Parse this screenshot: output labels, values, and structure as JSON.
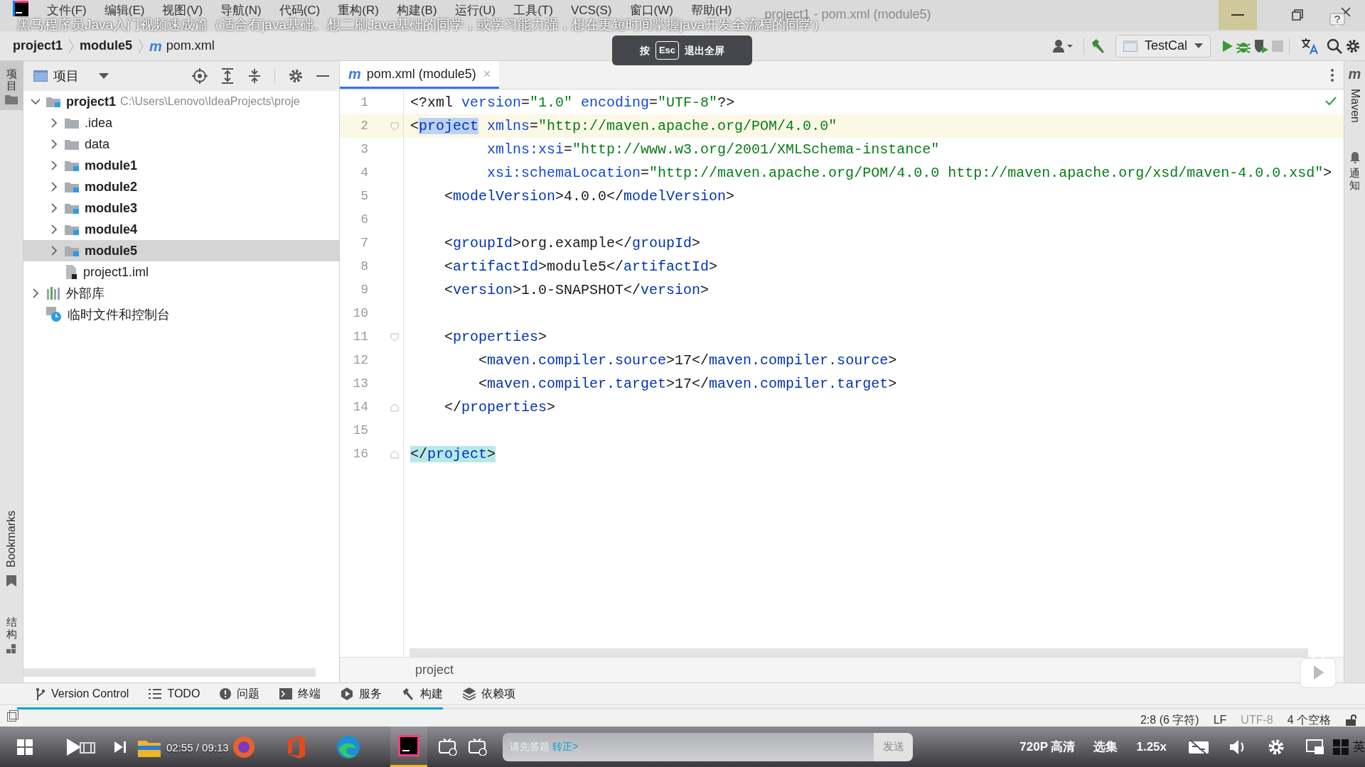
{
  "window": {
    "title": "project1 - pom.xml (module5)",
    "minimize_hovered": true,
    "menu": [
      "文件(F)",
      "编辑(E)",
      "视图(V)",
      "导航(N)",
      "代码(C)",
      "重构(R)",
      "构建(B)",
      "运行(U)",
      "工具(T)",
      "VCS(S)",
      "窗口(W)",
      "帮助(H)"
    ]
  },
  "video": {
    "title": "黑马程序员Java入门视频速成篇（适合有java基础、想二刷Java基础的同学，或学习能力强，想在更短时间掌握java开发全流程的同学）",
    "esc_hint": {
      "prefix": "按",
      "key": "Esc",
      "suffix": "退出全屏"
    },
    "progress": {
      "level": 0.316
    },
    "time_current": "02:55",
    "time_separator": "/",
    "time_total": "09:13",
    "danmaku": {
      "placeholder": "请先答题",
      "link": "转正>",
      "send": "发送"
    },
    "quality": "720P 高清",
    "episodes": "选集",
    "speed": "1.25x"
  },
  "breadcrumb": {
    "items": [
      "project1",
      "module5"
    ],
    "file_icon": "m",
    "file": "pom.xml"
  },
  "toolbar": {
    "run_config": "TestCal",
    "stop_enabled": false
  },
  "left_stripe": [
    {
      "kind": "vertical",
      "label": "项目",
      "selected": true
    },
    {
      "kind": "rotated",
      "label": "Bookmarks",
      "selected": false
    },
    {
      "kind": "vertical",
      "label": "结构",
      "selected": false
    }
  ],
  "project_panel": {
    "title": "项目",
    "tree": [
      {
        "label": "project1",
        "path": "C:\\Users\\Lenovo\\IdeaProjects\\proje",
        "kind": "project",
        "expanded": true,
        "selected": false,
        "children": [
          {
            "label": ".idea",
            "kind": "folder",
            "expanded": false,
            "selected": false
          },
          {
            "label": "data",
            "kind": "folder",
            "expanded": false,
            "selected": false
          },
          {
            "label": "module1",
            "kind": "module",
            "expanded": false,
            "selected": false
          },
          {
            "label": "module2",
            "kind": "module",
            "expanded": false,
            "selected": false
          },
          {
            "label": "module3",
            "kind": "module",
            "expanded": false,
            "selected": false
          },
          {
            "label": "module4",
            "kind": "module",
            "expanded": false,
            "selected": false
          },
          {
            "label": "module5",
            "kind": "module",
            "expanded": false,
            "selected": true
          },
          {
            "label": "project1.iml",
            "kind": "file",
            "selected": false
          }
        ]
      },
      {
        "label": "外部库",
        "kind": "library",
        "expanded": false,
        "selected": false
      },
      {
        "label": "临时文件和控制台",
        "kind": "scratch",
        "selected": false
      }
    ]
  },
  "editor": {
    "tab": {
      "icon": "m",
      "label": "pom.xml (module5)",
      "close": "×",
      "selected": true
    },
    "lines": [
      {
        "number": "1",
        "current": false,
        "tokens": [
          {
            "kind": "punct",
            "text": "<?xml "
          },
          {
            "kind": "attr",
            "text": "version"
          },
          {
            "kind": "punct",
            "text": "="
          },
          {
            "kind": "value",
            "text": "\"1.0\""
          },
          {
            "kind": "attr",
            "text": " encoding"
          },
          {
            "kind": "punct",
            "text": "="
          },
          {
            "kind": "value",
            "text": "\"UTF-8\""
          },
          {
            "kind": "punct",
            "text": "?>"
          }
        ]
      },
      {
        "number": "2",
        "current": true,
        "fold_start": true,
        "tokens": [
          {
            "kind": "punct",
            "text": "<"
          },
          {
            "kind": "tag",
            "text": "project",
            "selected": true
          },
          {
            "kind": "attr",
            "text": " xmlns"
          },
          {
            "kind": "punct",
            "text": "="
          },
          {
            "kind": "value",
            "text": "\"http://maven.apache.org/POM/4.0.0\""
          }
        ]
      },
      {
        "number": "3",
        "current": false,
        "tokens": [
          {
            "kind": "attr",
            "text": "         xmlns:xsi"
          },
          {
            "kind": "punct",
            "text": "="
          },
          {
            "kind": "value",
            "text": "\"http://www.w3.org/2001/XMLSchema-instance\""
          }
        ]
      },
      {
        "number": "4",
        "current": false,
        "tokens": [
          {
            "kind": "attr",
            "text": "         xsi:schemaLocation"
          },
          {
            "kind": "punct",
            "text": "="
          },
          {
            "kind": "value",
            "text": "\"http://maven.apache.org/POM/4.0.0 http://maven.apache.org/xsd/maven-4.0.0.xsd\""
          },
          {
            "kind": "punct",
            "text": ">"
          }
        ]
      },
      {
        "number": "5",
        "current": false,
        "tokens": [
          {
            "kind": "punct",
            "text": "    <"
          },
          {
            "kind": "tag",
            "text": "modelVersion"
          },
          {
            "kind": "punct",
            "text": ">4.0.0</"
          },
          {
            "kind": "tag",
            "text": "modelVersion"
          },
          {
            "kind": "punct",
            "text": ">"
          }
        ]
      },
      {
        "number": "6",
        "current": false
      },
      {
        "number": "7",
        "current": false,
        "tokens": [
          {
            "kind": "punct",
            "text": "    <"
          },
          {
            "kind": "tag",
            "text": "groupId"
          },
          {
            "kind": "punct",
            "text": ">org.example</"
          },
          {
            "kind": "tag",
            "text": "groupId"
          },
          {
            "kind": "punct",
            "text": ">"
          }
        ]
      },
      {
        "number": "8",
        "current": false,
        "tokens": [
          {
            "kind": "punct",
            "text": "    <"
          },
          {
            "kind": "tag",
            "text": "artifactId"
          },
          {
            "kind": "punct",
            "text": ">module5</"
          },
          {
            "kind": "tag",
            "text": "artifactId"
          },
          {
            "kind": "punct",
            "text": ">"
          }
        ]
      },
      {
        "number": "9",
        "current": false,
        "tokens": [
          {
            "kind": "punct",
            "text": "    <"
          },
          {
            "kind": "tag",
            "text": "version"
          },
          {
            "kind": "punct",
            "text": ">1.0-SNAPSHOT</"
          },
          {
            "kind": "tag",
            "text": "version"
          },
          {
            "kind": "punct",
            "text": ">"
          }
        ]
      },
      {
        "number": "10",
        "current": false
      },
      {
        "number": "11",
        "current": false,
        "fold_start": true,
        "tokens": [
          {
            "kind": "punct",
            "text": "    <"
          },
          {
            "kind": "tag",
            "text": "properties"
          },
          {
            "kind": "punct",
            "text": ">"
          }
        ]
      },
      {
        "number": "12",
        "current": false,
        "tokens": [
          {
            "kind": "punct",
            "text": "        <"
          },
          {
            "kind": "tag",
            "text": "maven.compiler.source"
          },
          {
            "kind": "punct",
            "text": ">17</"
          },
          {
            "kind": "tag",
            "text": "maven.compiler.source"
          },
          {
            "kind": "punct",
            "text": ">"
          }
        ]
      },
      {
        "number": "13",
        "current": false,
        "tokens": [
          {
            "kind": "punct",
            "text": "        <"
          },
          {
            "kind": "tag",
            "text": "maven.compiler.target"
          },
          {
            "kind": "punct",
            "text": ">17</"
          },
          {
            "kind": "tag",
            "text": "maven.compiler.target"
          },
          {
            "kind": "punct",
            "text": ">"
          }
        ]
      },
      {
        "number": "14",
        "current": false,
        "fold_end": true,
        "tokens": [
          {
            "kind": "punct",
            "text": "    </"
          },
          {
            "kind": "tag",
            "text": "properties"
          },
          {
            "kind": "punct",
            "text": ">"
          }
        ]
      },
      {
        "number": "15",
        "current": false
      },
      {
        "number": "16",
        "current": false,
        "fold_end": true,
        "tokens": [
          {
            "kind": "punct",
            "text": "</",
            "matched": true
          },
          {
            "kind": "tag",
            "text": "project",
            "matched": true
          },
          {
            "kind": "punct",
            "text": ">",
            "matched": true
          }
        ]
      }
    ],
    "path": "project"
  },
  "right_stripe": [
    {
      "kind": "rotated",
      "icon": "m",
      "label": "Maven"
    },
    {
      "kind": "vertical",
      "label": "通知"
    }
  ],
  "tool_windows": [
    "Version Control",
    "TODO",
    "问题",
    "终端",
    "服务",
    "构建",
    "依赖项"
  ],
  "status": {
    "position": "2:8 (6 字符)",
    "line_separator": "LF",
    "encoding": "UTF-8",
    "indent": "4 个空格"
  },
  "taskbar": {
    "ime": "英"
  }
}
